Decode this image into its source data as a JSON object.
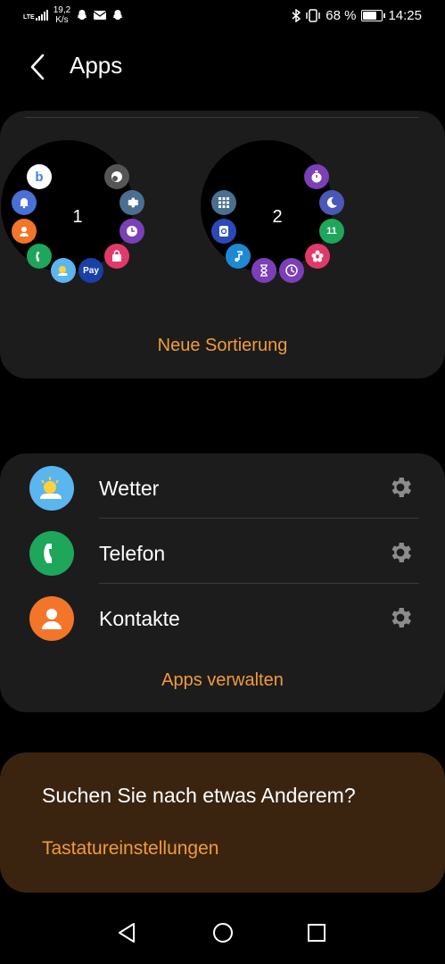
{
  "status_bar": {
    "network": "LTE",
    "speed": "19,2",
    "speed_unit": "K/s",
    "battery": "68 %",
    "battery_level": 0.68,
    "time": "14:25"
  },
  "header": {
    "title": "Apps"
  },
  "watch_pages": {
    "page1_number": "1",
    "page2_number": "2",
    "pay_label": "Pay",
    "calendar_label": "11",
    "reorder_label": "Neue Sortierung"
  },
  "apps": {
    "items": [
      {
        "label": "Wetter",
        "icon": "weather-icon",
        "color": "#5bb5ee"
      },
      {
        "label": "Telefon",
        "icon": "phone-icon",
        "color": "#1ea65a"
      },
      {
        "label": "Kontakte",
        "icon": "contacts-icon",
        "color": "#f2752a"
      }
    ],
    "manage_label": "Apps verwalten"
  },
  "search_card": {
    "title": "Suchen Sie nach etwas Anderem?",
    "link": "Tastatureinstellungen"
  },
  "colors": {
    "accent": "#f09b3a",
    "card": "#1c1c1c",
    "search_card": "#3a2410"
  }
}
